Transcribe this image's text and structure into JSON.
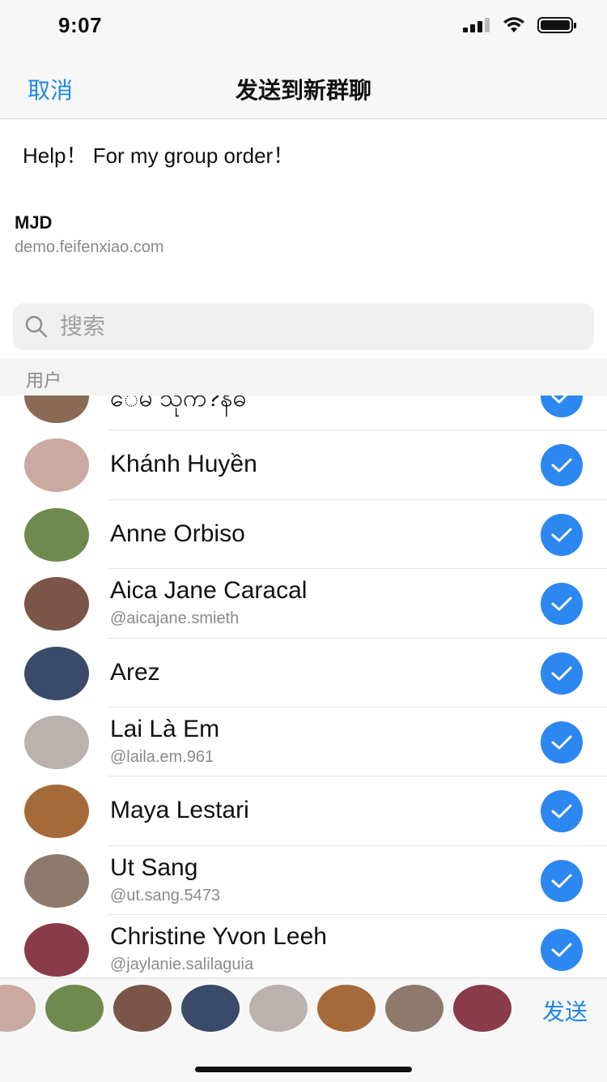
{
  "status_bar": {
    "time": "9:07"
  },
  "nav": {
    "cancel_label": "取消",
    "title": "发送到新群聊"
  },
  "share": {
    "message": "Help！ For my group order！",
    "link_title": "MJD",
    "link_url": "demo.feifenxiao.com"
  },
  "search": {
    "placeholder": "搜索"
  },
  "section": {
    "label": "用户"
  },
  "users": [
    {
      "name": "ေမ သ်ုက?နဓ",
      "handle": "",
      "avatar_color": "#8a6a55",
      "selected": true
    },
    {
      "name": "Khánh Huyền",
      "handle": "",
      "avatar_color": "#c9a9a0",
      "selected": true
    },
    {
      "name": "Anne Orbiso",
      "handle": "",
      "avatar_color": "#6e8a4e",
      "selected": true
    },
    {
      "name": "Aica Jane Caracal",
      "handle": "@aicajane.smieth",
      "avatar_color": "#7a5548",
      "selected": true
    },
    {
      "name": "Arez",
      "handle": "",
      "avatar_color": "#3a4a6a",
      "selected": true
    },
    {
      "name": "Lai Là Em",
      "handle": "@laila.em.961",
      "avatar_color": "#b9b2ae",
      "selected": true
    },
    {
      "name": "Maya Lestari",
      "handle": "",
      "avatar_color": "#a56a3a",
      "selected": true
    },
    {
      "name": "Ut Sang",
      "handle": "@ut.sang.5473",
      "avatar_color": "#8d7a6d",
      "selected": true
    },
    {
      "name": "Christine Yvon Leeh",
      "handle": "@jaylanie.salilaguia",
      "avatar_color": "#8a3b4a",
      "selected": true
    }
  ],
  "selected_avatars": [
    {
      "name": "Khánh Huyền",
      "avatar_color": "#c9a9a0"
    },
    {
      "name": "Anne Orbiso",
      "avatar_color": "#6e8a4e"
    },
    {
      "name": "Aica Jane Caracal",
      "avatar_color": "#7a5548"
    },
    {
      "name": "Arez",
      "avatar_color": "#3a4a6a"
    },
    {
      "name": "Lai Là Em",
      "avatar_color": "#b9b2ae"
    },
    {
      "name": "Maya Lestari",
      "avatar_color": "#a56a3a"
    },
    {
      "name": "Ut Sang",
      "avatar_color": "#8d7a6d"
    },
    {
      "name": "Christine Yvon Leeh",
      "avatar_color": "#8a3b4a"
    }
  ],
  "bottom": {
    "send_label": "发送"
  },
  "colors": {
    "accent": "#1e88e5",
    "check": "#2d87f0"
  }
}
